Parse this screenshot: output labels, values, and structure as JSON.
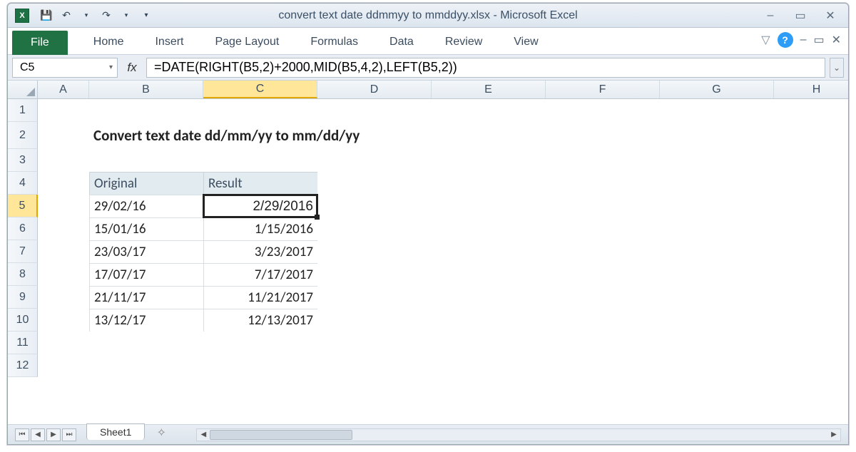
{
  "app": {
    "title": "convert text date ddmmyy to mmddyy.xlsx  -  Microsoft Excel"
  },
  "ribbon": {
    "file": "File",
    "tabs": [
      "Home",
      "Insert",
      "Page Layout",
      "Formulas",
      "Data",
      "Review",
      "View"
    ]
  },
  "namebox": "C5",
  "formula": "=DATE(RIGHT(B5,2)+2000,MID(B5,4,2),LEFT(B5,2))",
  "columns": [
    "A",
    "B",
    "C",
    "D",
    "E",
    "F",
    "G",
    "H"
  ],
  "selected_col": "C",
  "selected_row": 5,
  "content": {
    "title": "Convert text date dd/mm/yy to mm/dd/yy",
    "headers": {
      "original": "Original",
      "result": "Result"
    },
    "rows": [
      {
        "original": "29/02/16",
        "result": "2/29/2016"
      },
      {
        "original": "15/01/16",
        "result": "1/15/2016"
      },
      {
        "original": "23/03/17",
        "result": "3/23/2017"
      },
      {
        "original": "17/07/17",
        "result": "7/17/2017"
      },
      {
        "original": "21/11/17",
        "result": "11/21/2017"
      },
      {
        "original": "13/12/17",
        "result": "12/13/2017"
      }
    ]
  },
  "sheet_tab": "Sheet1",
  "chart_data": {
    "type": "table",
    "title": "Convert text date dd/mm/yy to mm/dd/yy",
    "columns": [
      "Original",
      "Result"
    ],
    "rows": [
      [
        "29/02/16",
        "2/29/2016"
      ],
      [
        "15/01/16",
        "1/15/2016"
      ],
      [
        "23/03/17",
        "3/23/2017"
      ],
      [
        "17/07/17",
        "7/17/2017"
      ],
      [
        "21/11/17",
        "11/21/2017"
      ],
      [
        "13/12/17",
        "12/13/2017"
      ]
    ]
  }
}
